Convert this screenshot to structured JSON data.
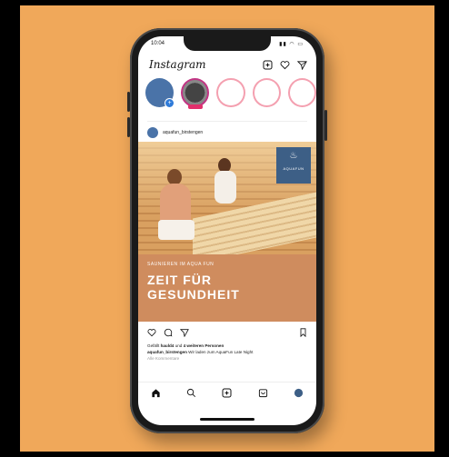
{
  "status": {
    "time": "10:04",
    "icons": "▮▮ ◠ ▭"
  },
  "app": {
    "name": "Instagram"
  },
  "icons": {
    "new_post": "plus-square-icon",
    "heart": "heart-icon",
    "direct": "paper-plane-icon",
    "comment": "comment-icon",
    "bookmark": "bookmark-icon",
    "home": "home-icon",
    "search": "search-icon",
    "add": "add-icon",
    "shop": "shop-icon",
    "profile": "profile-icon"
  },
  "stories": {
    "me_plus": "+",
    "live_label": "LIVE"
  },
  "post": {
    "username": "aquafun_birstengen",
    "logo_mark": "♨",
    "logo_text": "AQUAFUN",
    "banner_subtitle": "SAUNIEREN IM AQUA FUN",
    "banner_title_line1": "ZEIT FÜR",
    "banner_title_line2": "GESUNDHEIT",
    "liked_by_prefix": "Gefällt ",
    "liked_by_user": "hauld4",
    "liked_by_suffix": " und ",
    "liked_by_others": "4 weiteren Personen",
    "caption_user": "aquafun_birstengen",
    "caption_text": " Wir laden zum AquaFun Late Night",
    "comments_link": "Alle Kommentare"
  },
  "colors": {
    "background": "#f0a85a",
    "banner": "#cf8c5e",
    "logo_box": "#3d5f86",
    "accent": "#2f7bd9"
  }
}
